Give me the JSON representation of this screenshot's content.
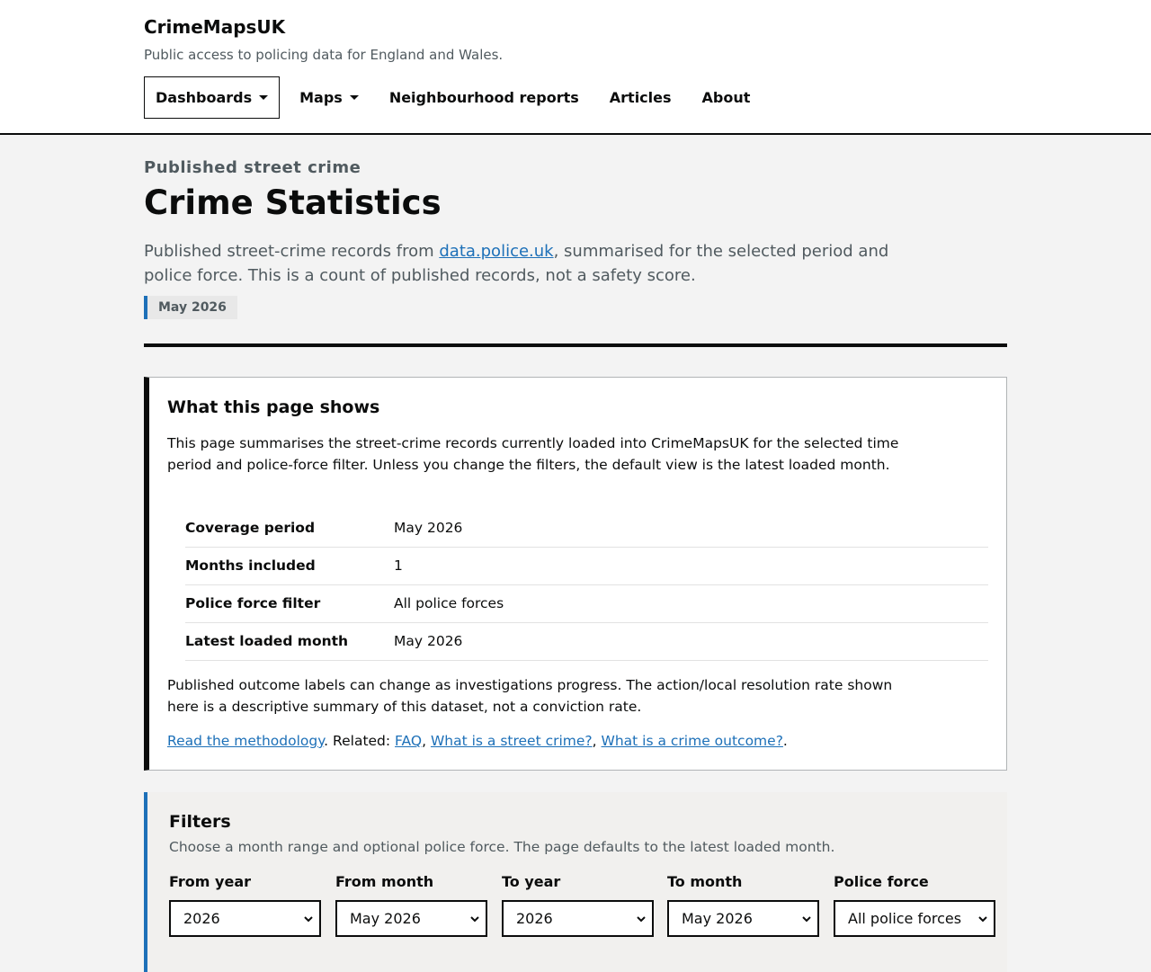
{
  "header": {
    "brand": "CrimeMapsUK",
    "tagline": "Public access to policing data for England and Wales.",
    "nav": [
      {
        "label": "Dashboards",
        "dropdown": true,
        "active": true
      },
      {
        "label": "Maps",
        "dropdown": true,
        "active": false
      },
      {
        "label": "Neighbourhood reports",
        "dropdown": false,
        "active": false
      },
      {
        "label": "Articles",
        "dropdown": false,
        "active": false
      },
      {
        "label": "About",
        "dropdown": false,
        "active": false
      }
    ]
  },
  "hero": {
    "eyebrow": "Published street crime",
    "title": "Crime Statistics",
    "lede_before": "Published street-crime records from ",
    "lede_link": "data.police.uk",
    "lede_after": ", summarised for the selected period and police force. This is a count of published records, not a safety score.",
    "period_tag": "May 2026"
  },
  "info": {
    "heading": "What this page shows",
    "intro": "This page summarises the street-crime records currently loaded into CrimeMapsUK for the selected time period and police-force filter. Unless you change the filters, the default view is the latest loaded month.",
    "rows": [
      {
        "key": "Coverage period",
        "value": "May 2026"
      },
      {
        "key": "Months included",
        "value": "1"
      },
      {
        "key": "Police force filter",
        "value": "All police forces"
      },
      {
        "key": "Latest loaded month",
        "value": "May 2026"
      }
    ],
    "note": "Published outcome labels can change as investigations progress. The action/local resolution rate shown here is a descriptive summary of this dataset, not a conviction rate.",
    "methodology_link": "Read the methodology",
    "related_label": ". Related: ",
    "related_links": [
      "FAQ",
      "What is a street crime?",
      "What is a crime outcome?"
    ],
    "sep": ", ",
    "end": "."
  },
  "filters": {
    "heading": "Filters",
    "hint": "Choose a month range and optional police force. The page defaults to the latest loaded month.",
    "fields": [
      {
        "label": "From year",
        "value": "2026"
      },
      {
        "label": "From month",
        "value": "May 2026"
      },
      {
        "label": "To year",
        "value": "2026"
      },
      {
        "label": "To month",
        "value": "May 2026"
      },
      {
        "label": "Police force",
        "value": "All police forces"
      }
    ]
  }
}
